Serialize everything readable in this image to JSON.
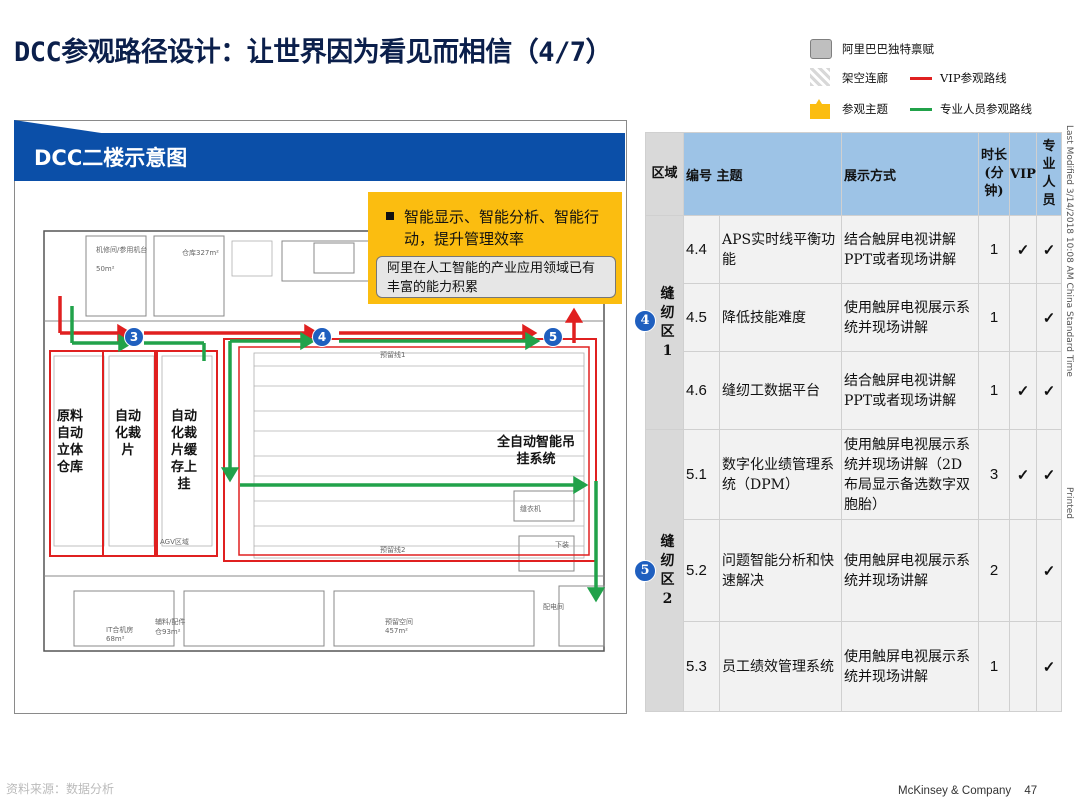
{
  "title": "DCC参观路径设计：让世界因为看见而相信（4/7）",
  "legend": {
    "items": [
      {
        "label": "阿里巴巴独特禀赋"
      },
      {
        "label": "架空连廊"
      },
      {
        "label": "VIP参观路线",
        "color": "#e02020"
      },
      {
        "label": "参观主题"
      },
      {
        "label": "专业人员参观路线",
        "color": "#21a24a"
      }
    ]
  },
  "side_text": {
    "modified": "Last Modified 3/14/2018 10:08 AM China Standard Time",
    "printed": "Printed"
  },
  "panel": {
    "title": "DCC二楼示意图",
    "callout_point": "智能显示、智能分析、智能行动，提升管理效率",
    "callout_note": "阿里在人工智能的产业应用领域已有丰富的能力积累"
  },
  "floorplan": {
    "areas": [
      {
        "label": "原料自动立体仓库"
      },
      {
        "label": "自动化裁片"
      },
      {
        "label": "自动化裁片缓存上挂"
      },
      {
        "label": "全自动智能吊挂系统"
      }
    ],
    "badges": [
      "3",
      "4",
      "5"
    ],
    "small_labels": [
      "机修间/参用机台",
      "50m²",
      "仓库327m²",
      "预留线1",
      "预留线2",
      "AGV区域",
      "配电间",
      "IT合机房",
      "68m²",
      "辅料/配件",
      "仓93m²",
      "预留空间",
      "457m²",
      "下装",
      "缝衣机"
    ]
  },
  "table": {
    "headers": {
      "zone": "区域",
      "code_theme": "编号 主题",
      "method": "展示方式",
      "duration": "时长(分钟)",
      "vip": "VIP",
      "pro": "专业人员"
    },
    "zones": [
      {
        "badge": "4",
        "name": "缝纫区1"
      },
      {
        "badge": "5",
        "name": "缝纫区2"
      }
    ],
    "rows": [
      {
        "code": "4.4",
        "theme": "APS实时线平衡功能",
        "method": "结合触屏电视讲解PPT或者现场讲解",
        "duration": "1",
        "vip": "✓",
        "pro": "✓"
      },
      {
        "code": "4.5",
        "theme": "降低技能难度",
        "method": "使用触屏电视展示系统并现场讲解",
        "duration": "1",
        "vip": "",
        "pro": "✓"
      },
      {
        "code": "4.6",
        "theme": "缝纫工数据平台",
        "method": "结合触屏电视讲解PPT或者现场讲解",
        "duration": "1",
        "vip": "✓",
        "pro": "✓"
      },
      {
        "code": "5.1",
        "theme": "数字化业绩管理系统（DPM）",
        "method": "使用触屏电视展示系统并现场讲解（2D布局显示备选数字双胞胎）",
        "duration": "3",
        "vip": "✓",
        "pro": "✓"
      },
      {
        "code": "5.2",
        "theme": "问题智能分析和快速解决",
        "method": "使用触屏电视展示系统并现场讲解",
        "duration": "2",
        "vip": "",
        "pro": "✓"
      },
      {
        "code": "5.3",
        "theme": "员工绩效管理系统",
        "method": "使用触屏电视展示系统并现场讲解",
        "duration": "1",
        "vip": "",
        "pro": "✓"
      }
    ]
  },
  "footer": {
    "watermark": "资料来源：数据分析",
    "company": "McKinsey & Company",
    "page": "47"
  }
}
